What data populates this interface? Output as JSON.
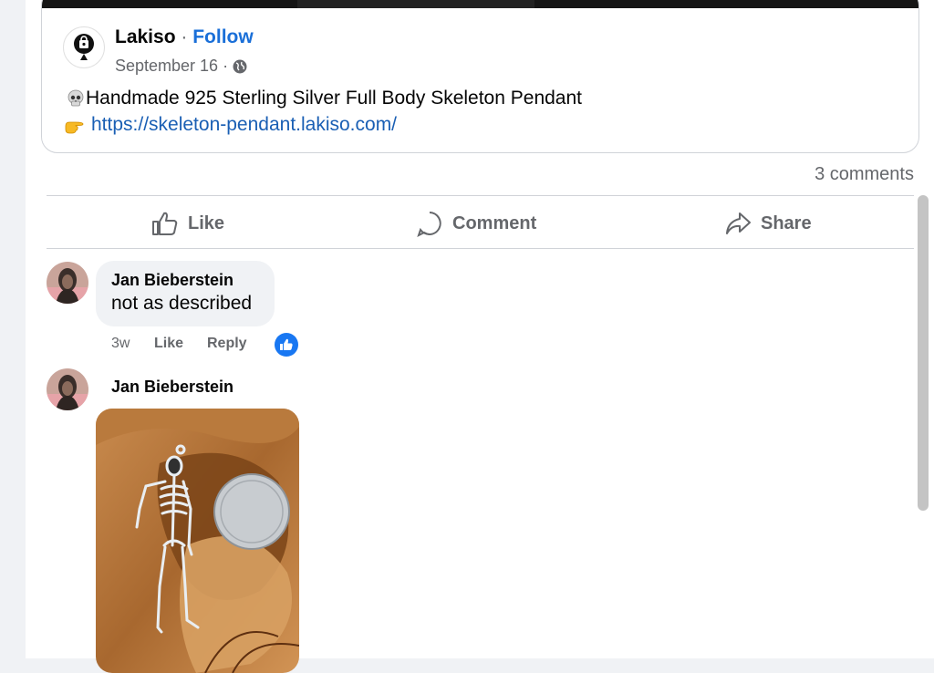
{
  "post": {
    "author": "Lakiso",
    "separator": "·",
    "follow_label": "Follow",
    "date": "September 16 ·",
    "text": "Handmade 925 Sterling Silver Full Body Skeleton Pendant",
    "link": "https://skeleton-pendant.lakiso.com/",
    "comments_count": "3 comments"
  },
  "actions": {
    "like": "Like",
    "comment": "Comment",
    "share": "Share"
  },
  "comments": [
    {
      "author": "Jan Bieberstein",
      "text": "not as described",
      "time": "3w",
      "like_label": "Like",
      "reply_label": "Reply"
    },
    {
      "author": "Jan Bieberstein"
    }
  ],
  "colors": {
    "link": "#1a5fb4",
    "follow": "#1a6fd8",
    "secondary_text": "#65676b",
    "like_badge": "#1877f2"
  }
}
